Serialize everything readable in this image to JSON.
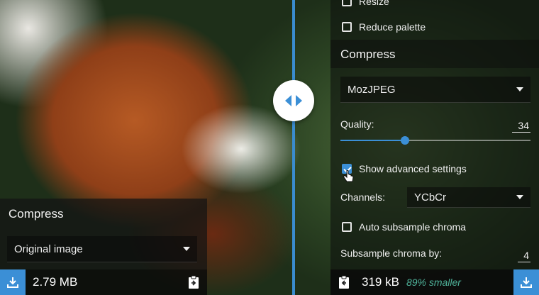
{
  "left": {
    "panel_title": "Compress",
    "method_select": "Original image",
    "file_size": "2.79 MB"
  },
  "right": {
    "resize_label": "Resize",
    "reduce_palette_label": "Reduce palette",
    "panel_title": "Compress",
    "method_select": "MozJPEG",
    "quality_label": "Quality:",
    "quality_value": "34",
    "quality_level": 0.34,
    "advanced_label": "Show advanced settings",
    "channels_label": "Channels:",
    "channels_select": "YCbCr",
    "auto_subsample_label": "Auto subsample chroma",
    "subsample_label": "Subsample chroma by:",
    "subsample_value": "4",
    "file_size": "319 kB",
    "savings": "89% smaller"
  },
  "colors": {
    "accent": "#3b8fd6",
    "savings": "#4fb39a"
  },
  "icons": [
    "swap-arrows-icon",
    "download-icon",
    "copy-settings-icon",
    "hand-cursor-icon"
  ]
}
